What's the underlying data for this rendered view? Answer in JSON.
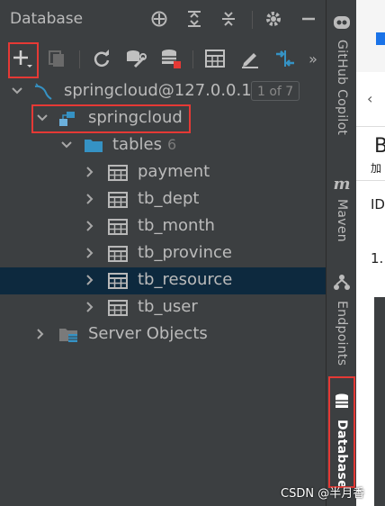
{
  "panel": {
    "title": "Database"
  },
  "tree": {
    "connection": {
      "label": "springcloud@127.0.0.1",
      "badge": "1 of 7"
    },
    "schema": {
      "label": "springcloud"
    },
    "tables": {
      "label": "tables",
      "count": "6"
    },
    "table_items": [
      "payment",
      "tb_dept",
      "tb_month",
      "tb_province",
      "tb_resource",
      "tb_user"
    ],
    "server_objects": {
      "label": "Server Objects"
    }
  },
  "side_strip": {
    "tabs": [
      "GitHub Copilot",
      "Maven",
      "Endpoints",
      "Database"
    ]
  },
  "editor_fragment": {
    "line1": "B",
    "line2": "加",
    "line3": "ID",
    "line4": "1."
  },
  "watermark": "CSDN @半月香",
  "colors": {
    "panel_bg": "#3c3f41",
    "selected_row": "#0d293e",
    "folder_blue": "#3592c4",
    "highlight_red": "#e53935"
  }
}
